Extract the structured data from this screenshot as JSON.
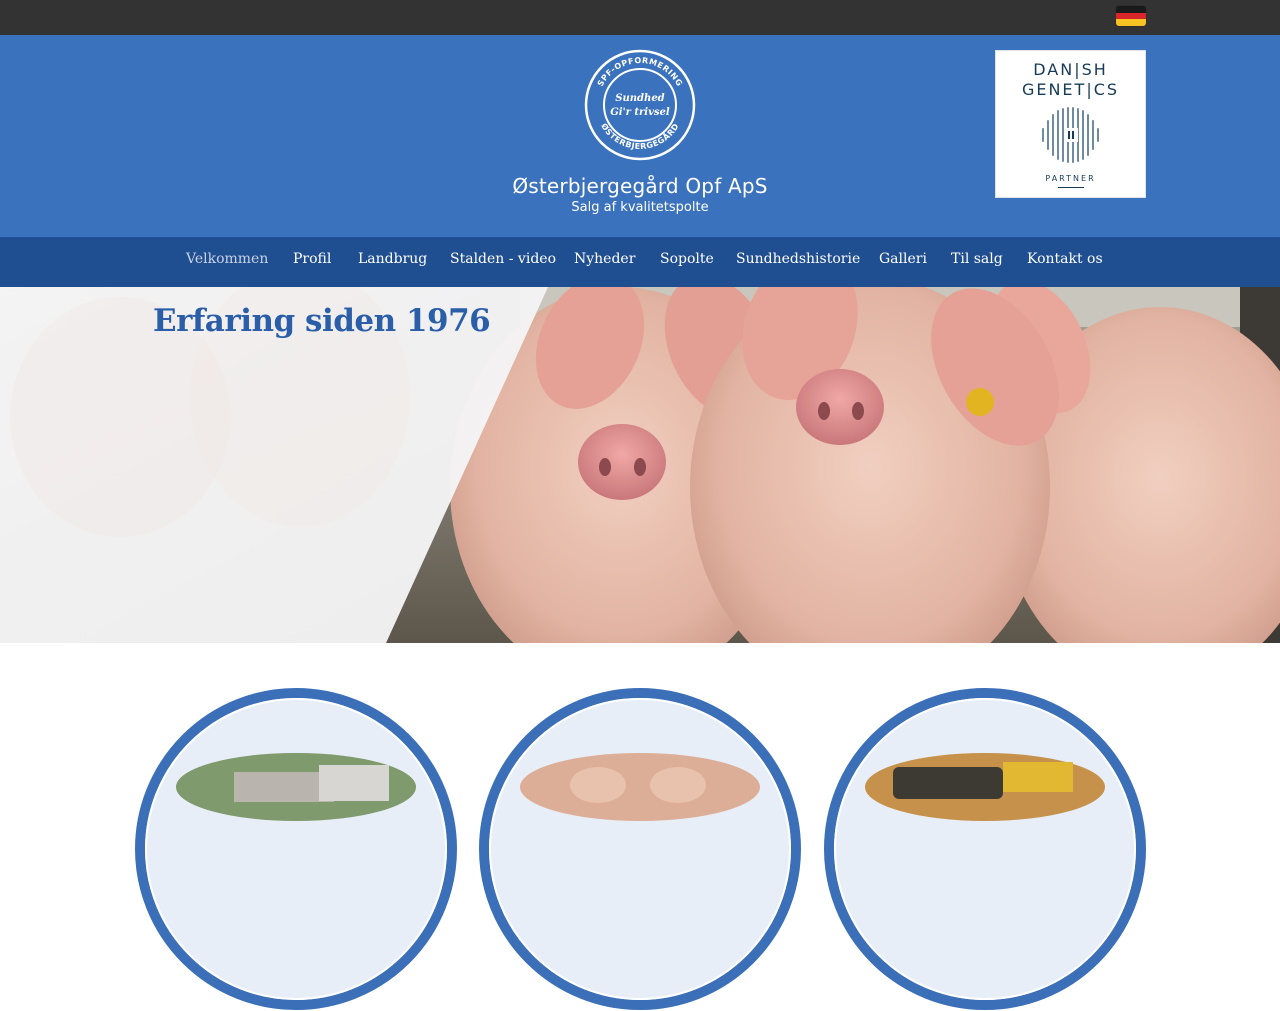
{
  "topbar": {
    "language_flag": "germany-flag-icon"
  },
  "brand": {
    "seal_text_top": "SPF-OPFORMERING",
    "seal_text_middle_1": "Sundhed",
    "seal_text_middle_2": "Gi'r trivsel",
    "seal_text_bottom": "ØSTERBJERGEGÅRD",
    "name": "Østerbjergegård Opf ApS",
    "tagline": "Salg af kvalitetspolte"
  },
  "partner": {
    "line1": "DAN|SH",
    "line2": "GENET|CS",
    "line3": "PARTNER"
  },
  "nav": {
    "items": [
      {
        "label": "Velkommen",
        "active": true
      },
      {
        "label": "Profil"
      },
      {
        "label": "Landbrug"
      },
      {
        "label": "Stalden - video"
      },
      {
        "label": "Nyheder"
      },
      {
        "label": "Sopolte"
      },
      {
        "label": "Sundhedshistorie"
      },
      {
        "label": "Galleri"
      },
      {
        "label": "Til salg"
      },
      {
        "label": "Kontakt os"
      }
    ]
  },
  "hero": {
    "title": "Erfaring siden 1976"
  },
  "colors": {
    "topbar": "#333333",
    "header": "#3b72bd",
    "nav": "#1f4e91",
    "accent_title": "#2a5ea8"
  }
}
